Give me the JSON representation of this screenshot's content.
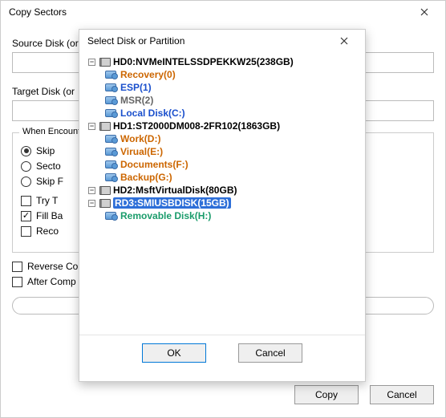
{
  "main": {
    "title": "Copy Sectors",
    "source_label": "Source Disk (or",
    "target_label": "Target Disk (or",
    "group_title": "When Encount",
    "options": {
      "skip1": "Skip",
      "sector": "Secto",
      "skip2": "Skip F",
      "tryt": "Try T",
      "fill": "Fill Ba",
      "reco": "Reco"
    },
    "reverse": "Reverse Co",
    "after": "After Comp",
    "copy": "Copy",
    "cancel": "Cancel"
  },
  "modal": {
    "title": "Select Disk or Partition",
    "ok": "OK",
    "cancel": "Cancel",
    "disks": [
      {
        "label": "HD0:NVMeINTELSSDPEKKW25(238GB)",
        "parts": [
          {
            "label": "Recovery(0)",
            "cls": "leaf"
          },
          {
            "label": "ESP(1)",
            "cls": "leaf blue"
          },
          {
            "label": "MSR(2)",
            "cls": "leaf grey"
          },
          {
            "label": "Local Disk(C:)",
            "cls": "leaf blue"
          }
        ]
      },
      {
        "label": "HD1:ST2000DM008-2FR102(1863GB)",
        "parts": [
          {
            "label": "Work(D:)",
            "cls": "leaf"
          },
          {
            "label": "Virual(E:)",
            "cls": "leaf"
          },
          {
            "label": "Documents(F:)",
            "cls": "leaf"
          },
          {
            "label": "Backup(G:)",
            "cls": "leaf"
          }
        ]
      },
      {
        "label": "HD2:MsftVirtualDisk(80GB)",
        "parts": []
      },
      {
        "label": "RD3:SMIUSBDISK(15GB)",
        "selected": true,
        "parts": [
          {
            "label": "Removable Disk(H:)",
            "cls": "leaf green"
          }
        ]
      }
    ]
  }
}
